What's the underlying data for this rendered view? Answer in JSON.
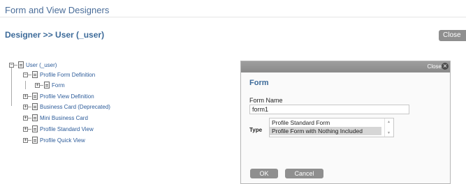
{
  "page": {
    "title": "Form and View Designers",
    "heading": "Designer >> User (_user)",
    "close_button": "Close"
  },
  "tree": {
    "root": {
      "label": "User (_user)",
      "toggle": "−"
    },
    "items": [
      {
        "label": "Profile Form Definition",
        "toggle": "−"
      },
      {
        "label": "Form",
        "toggle": "+"
      },
      {
        "label": "Profile View Definition",
        "toggle": "+"
      },
      {
        "label": "Business Card (Deprecated)",
        "toggle": "+"
      },
      {
        "label": "Mini Business Card",
        "toggle": "+"
      },
      {
        "label": "Profile Standard View",
        "toggle": "+"
      },
      {
        "label": "Profile Quick View",
        "toggle": "+"
      }
    ]
  },
  "dialog": {
    "close_label": "Close",
    "close_icon": "close-icon",
    "heading": "Form",
    "form_name_label": "Form Name",
    "form_name_value": "form1",
    "type_label": "Type",
    "type_options": [
      {
        "label": "Profile Standard Form",
        "selected": false
      },
      {
        "label": "Profile Form with Nothing Included",
        "selected": true
      }
    ],
    "ok_button": "OK",
    "cancel_button": "Cancel"
  }
}
